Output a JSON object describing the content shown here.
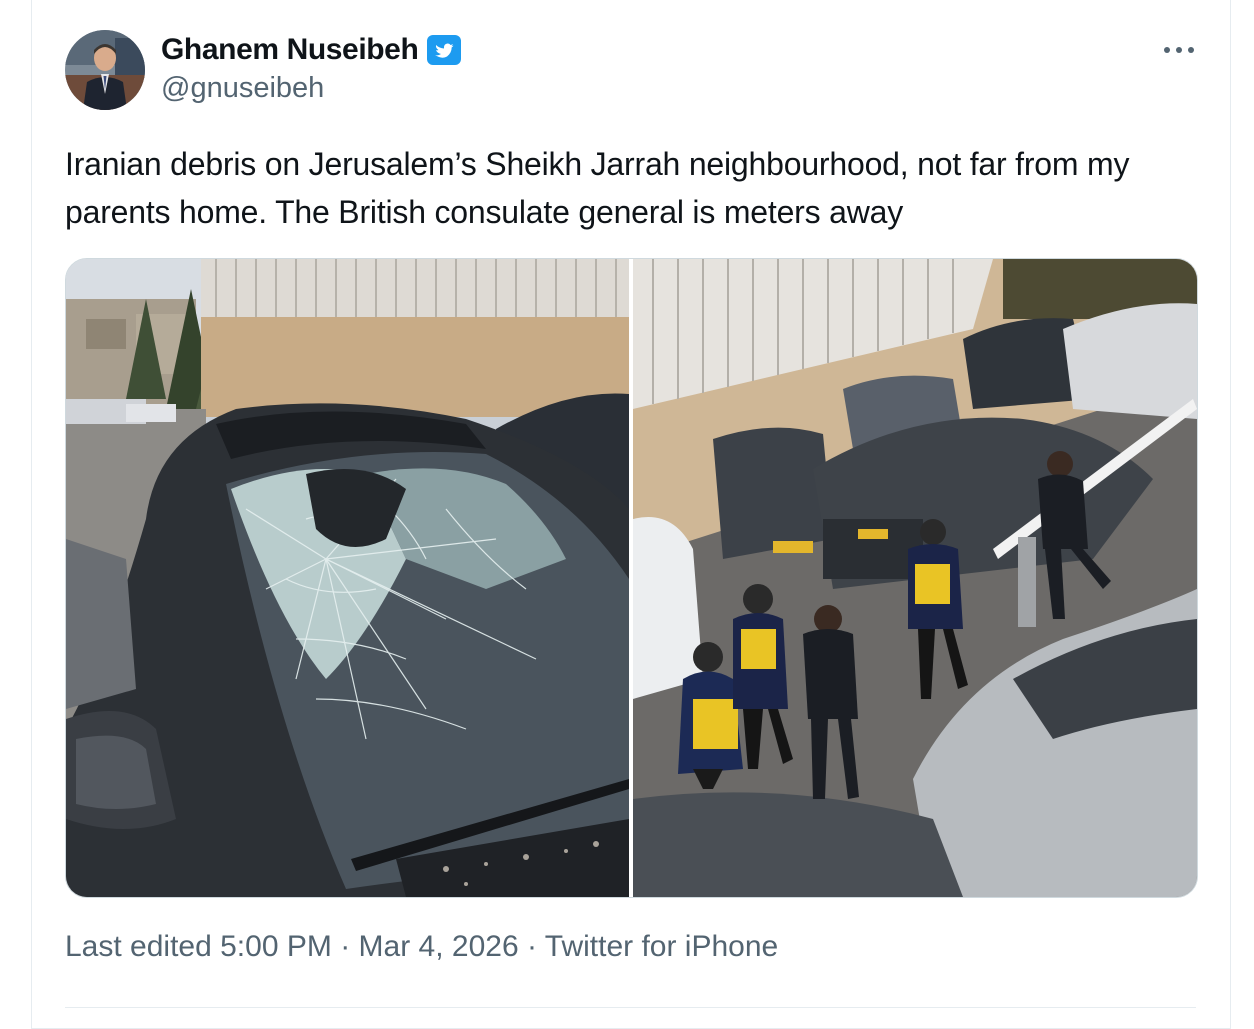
{
  "author": {
    "display_name": "Ghanem Nuseibeh",
    "handle": "@gnuseibeh",
    "verified_icon": "verified-badge-icon"
  },
  "tweet": {
    "text": "Iranian debris on Jerusalem’s Sheikh Jarrah neighbourhood, not far from my parents home. The British consulate general is meters away"
  },
  "meta": {
    "edited_label": "Last edited",
    "time": "5:00 PM",
    "date": "Mar 4, 2026",
    "source": "Twitter for iPhone",
    "separator": "·"
  },
  "colors": {
    "verified_blue": "#1d9bf0",
    "secondary_text": "#536471"
  }
}
